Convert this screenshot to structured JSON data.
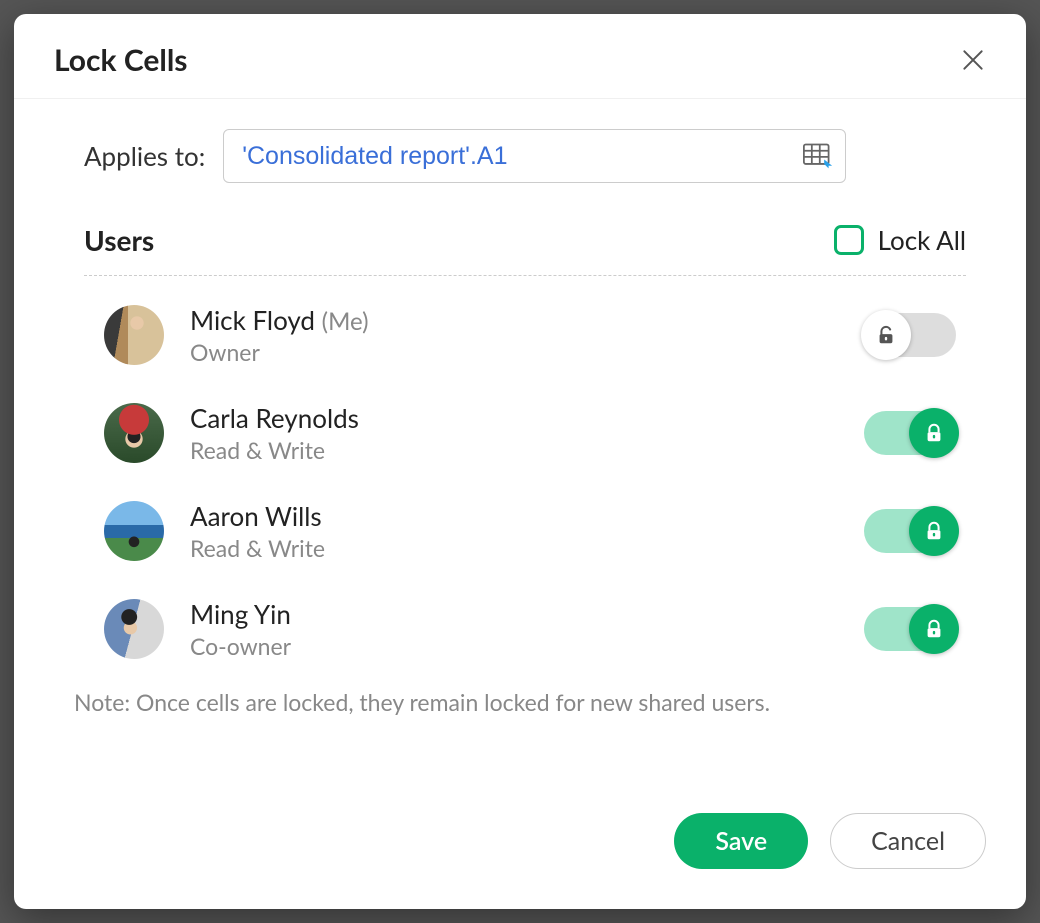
{
  "dialog": {
    "title": "Lock Cells"
  },
  "applies": {
    "label": "Applies to:",
    "value": "'Consolidated report'.A1"
  },
  "users": {
    "title": "Users",
    "lock_all_label": "Lock All",
    "lock_all_checked": false,
    "list": [
      {
        "name": "Mick Floyd",
        "me": "(Me)",
        "role": "Owner",
        "locked": false
      },
      {
        "name": "Carla Reynolds",
        "me": "",
        "role": "Read & Write",
        "locked": true
      },
      {
        "name": "Aaron Wills",
        "me": "",
        "role": "Read & Write",
        "locked": true
      },
      {
        "name": "Ming Yin",
        "me": "",
        "role": "Co-owner",
        "locked": true
      }
    ]
  },
  "note": "Note:  Once cells are locked, they remain locked for new shared users.",
  "buttons": {
    "save": "Save",
    "cancel": "Cancel"
  }
}
